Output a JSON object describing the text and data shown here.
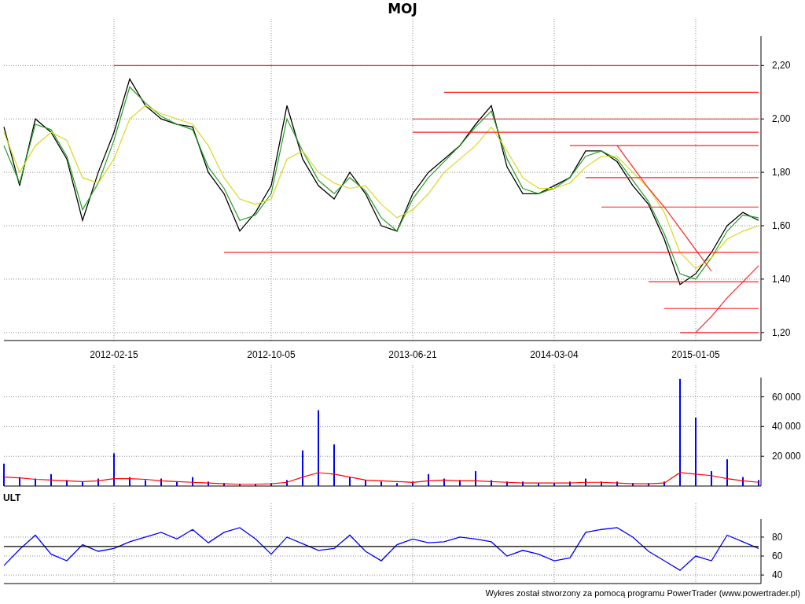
{
  "title": "MOJ",
  "price_chart": {
    "chart_data": {
      "type": "line",
      "grid": true,
      "ylim": [
        1.17,
        2.31
      ],
      "categories": [
        null,
        null,
        null,
        null,
        null,
        null,
        null,
        "2012-02-15",
        null,
        null,
        null,
        null,
        null,
        null,
        null,
        null,
        null,
        "2012-10-05",
        null,
        null,
        null,
        null,
        null,
        null,
        null,
        null,
        "2013-06-21",
        null,
        null,
        null,
        null,
        null,
        null,
        null,
        null,
        "2014-03-04",
        null,
        null,
        null,
        null,
        null,
        null,
        null,
        null,
        "2015-01-05",
        null,
        null,
        null,
        null
      ],
      "series": [
        {
          "color": "#000000",
          "values": [
            1.97,
            1.75,
            2.0,
            1.95,
            1.85,
            1.62,
            1.8,
            1.95,
            2.15,
            2.05,
            2.0,
            1.98,
            1.97,
            1.8,
            1.72,
            1.58,
            1.65,
            1.75,
            2.05,
            1.85,
            1.75,
            1.7,
            1.8,
            1.72,
            1.6,
            1.58,
            1.72,
            1.8,
            1.85,
            1.9,
            1.98,
            2.05,
            1.82,
            1.72,
            1.72,
            1.75,
            1.78,
            1.88,
            1.88,
            1.84,
            1.75,
            1.68,
            1.55,
            1.38,
            1.42,
            1.5,
            1.6,
            1.65,
            1.62
          ]
        },
        {
          "color": "#22a022",
          "values": [
            1.9,
            1.76,
            1.98,
            1.96,
            1.86,
            1.66,
            1.76,
            1.92,
            2.12,
            2.06,
            2.01,
            1.98,
            1.96,
            1.82,
            1.74,
            1.62,
            1.64,
            1.72,
            2.0,
            1.88,
            1.77,
            1.72,
            1.78,
            1.73,
            1.63,
            1.58,
            1.7,
            1.78,
            1.84,
            1.9,
            1.97,
            2.03,
            1.85,
            1.74,
            1.72,
            1.74,
            1.78,
            1.86,
            1.88,
            1.85,
            1.77,
            1.69,
            1.57,
            1.42,
            1.4,
            1.48,
            1.58,
            1.64,
            1.63
          ]
        },
        {
          "color": "#d8d820",
          "values": [
            1.95,
            1.8,
            1.9,
            1.95,
            1.92,
            1.78,
            1.76,
            1.85,
            2.0,
            2.05,
            2.02,
            2.0,
            1.98,
            1.9,
            1.78,
            1.7,
            1.68,
            1.7,
            1.85,
            1.88,
            1.8,
            1.76,
            1.74,
            1.75,
            1.68,
            1.63,
            1.66,
            1.72,
            1.8,
            1.85,
            1.9,
            1.97,
            1.88,
            1.78,
            1.74,
            1.74,
            1.76,
            1.82,
            1.86,
            1.86,
            1.8,
            1.74,
            1.65,
            1.5,
            1.44,
            1.48,
            1.55,
            1.58,
            1.6
          ]
        },
        {
          "color": "#ff2020",
          "values": [
            null,
            null,
            null,
            null,
            null,
            null,
            null,
            2.2,
            2.2,
            2.2,
            2.2,
            2.2,
            2.2,
            2.2,
            2.2,
            2.2,
            2.2,
            2.2,
            2.2,
            2.2,
            2.2,
            2.2,
            2.2,
            2.2,
            2.2,
            2.2,
            2.2,
            2.2,
            2.2,
            2.2,
            2.2,
            2.2,
            2.2,
            2.2,
            2.2,
            2.2,
            2.2,
            2.2,
            2.2,
            2.2,
            2.2,
            2.2,
            2.2,
            2.2,
            2.2,
            2.2,
            2.2,
            2.2,
            2.2
          ]
        },
        {
          "color": "#ff2020",
          "values": [
            null,
            null,
            null,
            null,
            null,
            null,
            null,
            null,
            null,
            null,
            null,
            null,
            null,
            null,
            null,
            null,
            null,
            null,
            null,
            null,
            null,
            null,
            null,
            null,
            null,
            null,
            null,
            null,
            2.1,
            2.1,
            2.1,
            2.1,
            2.1,
            2.1,
            2.1,
            2.1,
            2.1,
            2.1,
            2.1,
            2.1,
            2.1,
            2.1,
            2.1,
            2.1,
            2.1,
            2.1,
            2.1,
            2.1,
            2.1
          ]
        },
        {
          "color": "#ff2020",
          "values": [
            null,
            null,
            null,
            null,
            null,
            null,
            null,
            null,
            null,
            null,
            null,
            null,
            null,
            null,
            null,
            null,
            null,
            null,
            null,
            null,
            null,
            null,
            null,
            null,
            null,
            null,
            2.0,
            2.0,
            2.0,
            2.0,
            2.0,
            2.0,
            2.0,
            2.0,
            2.0,
            2.0,
            2.0,
            2.0,
            2.0,
            2.0,
            2.0,
            2.0,
            2.0,
            2.0,
            2.0,
            2.0,
            2.0,
            2.0,
            2.0
          ]
        },
        {
          "color": "#ff2020",
          "values": [
            null,
            null,
            null,
            null,
            null,
            null,
            null,
            null,
            null,
            null,
            null,
            null,
            null,
            null,
            null,
            null,
            null,
            null,
            null,
            null,
            null,
            null,
            null,
            null,
            null,
            null,
            1.95,
            1.95,
            1.95,
            1.95,
            1.95,
            1.95,
            1.95,
            1.95,
            1.95,
            1.95,
            1.95,
            1.95,
            1.95,
            1.95,
            1.95,
            1.95,
            1.95,
            1.95,
            1.95,
            1.95,
            1.95,
            1.95,
            1.95
          ]
        },
        {
          "color": "#ff2020",
          "values": [
            null,
            null,
            null,
            null,
            null,
            null,
            null,
            null,
            null,
            null,
            null,
            null,
            null,
            null,
            null,
            null,
            null,
            null,
            null,
            null,
            null,
            null,
            null,
            null,
            null,
            null,
            null,
            null,
            null,
            null,
            null,
            null,
            null,
            null,
            null,
            null,
            1.9,
            1.9,
            1.9,
            1.9,
            1.9,
            1.9,
            1.9,
            1.9,
            1.9,
            1.9,
            1.9,
            1.9,
            1.9
          ]
        },
        {
          "color": "#ff2020",
          "values": [
            null,
            null,
            null,
            null,
            null,
            null,
            null,
            null,
            null,
            null,
            null,
            null,
            null,
            null,
            null,
            null,
            null,
            null,
            null,
            null,
            null,
            null,
            null,
            null,
            null,
            null,
            null,
            null,
            null,
            null,
            null,
            null,
            null,
            null,
            null,
            null,
            null,
            1.78,
            1.78,
            1.78,
            1.78,
            1.78,
            1.78,
            1.78,
            1.78,
            1.78,
            1.78,
            1.78,
            1.78
          ]
        },
        {
          "color": "#ff2020",
          "values": [
            null,
            null,
            null,
            null,
            null,
            null,
            null,
            null,
            null,
            null,
            null,
            null,
            null,
            null,
            null,
            null,
            null,
            null,
            null,
            null,
            null,
            null,
            null,
            null,
            null,
            null,
            null,
            null,
            null,
            null,
            null,
            null,
            null,
            null,
            null,
            null,
            null,
            null,
            1.67,
            1.67,
            1.67,
            1.67,
            1.67,
            1.67,
            1.67,
            1.67,
            1.67,
            1.67,
            1.67
          ]
        },
        {
          "color": "#ff2020",
          "values": [
            null,
            null,
            null,
            null,
            null,
            null,
            null,
            null,
            null,
            null,
            null,
            null,
            null,
            null,
            1.5,
            1.5,
            1.5,
            1.5,
            1.5,
            1.5,
            1.5,
            1.5,
            1.5,
            1.5,
            1.5,
            1.5,
            1.5,
            1.5,
            1.5,
            1.5,
            1.5,
            1.5,
            1.5,
            1.5,
            1.5,
            1.5,
            1.5,
            1.5,
            1.5,
            1.5,
            1.5,
            1.5,
            1.5,
            1.5,
            1.5,
            1.5,
            1.5,
            1.5,
            1.5
          ]
        },
        {
          "color": "#ff2020",
          "values": [
            null,
            null,
            null,
            null,
            null,
            null,
            null,
            null,
            null,
            null,
            null,
            null,
            null,
            null,
            null,
            null,
            null,
            null,
            null,
            null,
            null,
            null,
            null,
            null,
            null,
            null,
            null,
            null,
            null,
            null,
            null,
            null,
            null,
            null,
            null,
            null,
            null,
            null,
            null,
            null,
            null,
            1.39,
            1.39,
            1.39,
            1.39,
            1.39,
            1.39,
            1.39,
            1.39
          ]
        },
        {
          "color": "#ff2020",
          "values": [
            null,
            null,
            null,
            null,
            null,
            null,
            null,
            null,
            null,
            null,
            null,
            null,
            null,
            null,
            null,
            null,
            null,
            null,
            null,
            null,
            null,
            null,
            null,
            null,
            null,
            null,
            null,
            null,
            null,
            null,
            null,
            null,
            null,
            null,
            null,
            null,
            null,
            null,
            null,
            null,
            null,
            null,
            1.29,
            1.29,
            1.29,
            1.29,
            1.29,
            1.29,
            1.29
          ]
        },
        {
          "color": "#ff2020",
          "values": [
            null,
            null,
            null,
            null,
            null,
            null,
            null,
            null,
            null,
            null,
            null,
            null,
            null,
            null,
            null,
            null,
            null,
            null,
            null,
            null,
            null,
            null,
            null,
            null,
            null,
            null,
            null,
            null,
            null,
            null,
            null,
            null,
            null,
            null,
            null,
            null,
            null,
            null,
            null,
            null,
            null,
            null,
            null,
            1.2,
            1.2,
            1.2,
            1.2,
            1.2,
            1.2
          ]
        },
        {
          "color": "#ff2020",
          "values": [
            null,
            null,
            null,
            null,
            null,
            null,
            null,
            null,
            null,
            null,
            null,
            null,
            null,
            null,
            null,
            null,
            null,
            null,
            null,
            null,
            null,
            null,
            null,
            null,
            null,
            null,
            null,
            null,
            null,
            null,
            null,
            null,
            null,
            null,
            null,
            null,
            null,
            null,
            null,
            1.9,
            1.82,
            1.74,
            1.67,
            1.59,
            1.51,
            1.43,
            null,
            null,
            null
          ]
        },
        {
          "color": "#ff2020",
          "values": [
            null,
            null,
            null,
            null,
            null,
            null,
            null,
            null,
            null,
            null,
            null,
            null,
            null,
            null,
            null,
            null,
            null,
            null,
            null,
            null,
            null,
            null,
            null,
            null,
            null,
            null,
            null,
            null,
            null,
            null,
            null,
            null,
            null,
            null,
            null,
            null,
            null,
            null,
            null,
            null,
            null,
            null,
            null,
            null,
            1.2,
            1.26,
            1.33,
            1.39,
            1.45
          ]
        }
      ],
      "yticks": [
        {
          "value": 1.2,
          "label": "1,20"
        },
        {
          "value": 1.4,
          "label": "1,40"
        },
        {
          "value": 1.6,
          "label": "1,60"
        },
        {
          "value": 1.8,
          "label": "1,80"
        },
        {
          "value": 2.0,
          "label": "2,00"
        },
        {
          "value": 2.2,
          "label": "2,20"
        }
      ]
    }
  },
  "volume_chart": {
    "chart_data": {
      "type": "bar",
      "grid": true,
      "ylim": [
        0,
        73000
      ],
      "series": [
        {
          "color": "#0000ff",
          "values": [
            15000,
            6000,
            5000,
            8000,
            4000,
            3000,
            5000,
            22000,
            6000,
            4000,
            5000,
            3000,
            6000,
            3000,
            2000,
            1500,
            1500,
            2000,
            4000,
            24000,
            51000,
            28000,
            6000,
            4000,
            3000,
            2000,
            3000,
            8000,
            5000,
            4000,
            10000,
            4000,
            3000,
            3000,
            2000,
            2000,
            3000,
            5000,
            3000,
            3000,
            2000,
            2000,
            3000,
            72000,
            46000,
            10000,
            18000,
            6000,
            4000
          ]
        },
        {
          "type": "line",
          "color": "#ff0000",
          "values": [
            6000,
            5500,
            4500,
            4000,
            3500,
            3000,
            3500,
            5000,
            5000,
            4500,
            3500,
            3000,
            2500,
            2000,
            1500,
            1200,
            1200,
            1500,
            2500,
            6000,
            9000,
            8000,
            6000,
            4000,
            3500,
            3000,
            2500,
            3500,
            4000,
            3500,
            3500,
            3000,
            2500,
            2000,
            2000,
            2000,
            2000,
            2500,
            2500,
            2000,
            1500,
            1500,
            2000,
            9000,
            8000,
            7000,
            5000,
            3500,
            2500
          ]
        }
      ],
      "yticks": [
        {
          "value": 20000,
          "label": "20 000"
        },
        {
          "value": 40000,
          "label": "40 000"
        },
        {
          "value": 60000,
          "label": "60 000"
        }
      ]
    }
  },
  "ult_chart": {
    "label": "ULT",
    "chart_data": {
      "type": "line",
      "grid": true,
      "ylim": [
        31,
        99
      ],
      "series": [
        {
          "color": "#0000ff",
          "values": [
            50,
            67,
            82,
            62,
            55,
            72,
            65,
            68,
            75,
            80,
            85,
            78,
            88,
            74,
            85,
            90,
            78,
            62,
            80,
            73,
            66,
            68,
            82,
            65,
            55,
            72,
            78,
            74,
            75,
            80,
            78,
            75,
            60,
            66,
            62,
            55,
            58,
            85,
            88,
            90,
            80,
            65,
            55,
            45,
            60,
            55,
            82,
            75,
            68
          ]
        },
        {
          "color": "#000000",
          "values": [
            70,
            70,
            70,
            70,
            70,
            70,
            70,
            70,
            70,
            70,
            70,
            70,
            70,
            70,
            70,
            70,
            70,
            70,
            70,
            70,
            70,
            70,
            70,
            70,
            70,
            70,
            70,
            70,
            70,
            70,
            70,
            70,
            70,
            70,
            70,
            70,
            70,
            70,
            70,
            70,
            70,
            70,
            70,
            70,
            70,
            70,
            70,
            70,
            70
          ]
        }
      ],
      "yticks": [
        {
          "value": 40,
          "label": "40"
        },
        {
          "value": 60,
          "label": "60"
        },
        {
          "value": 80,
          "label": "80"
        }
      ]
    }
  },
  "footer": "Wykres został stworzony za pomocą programu PowerTrader (www.powertrader.pl)"
}
